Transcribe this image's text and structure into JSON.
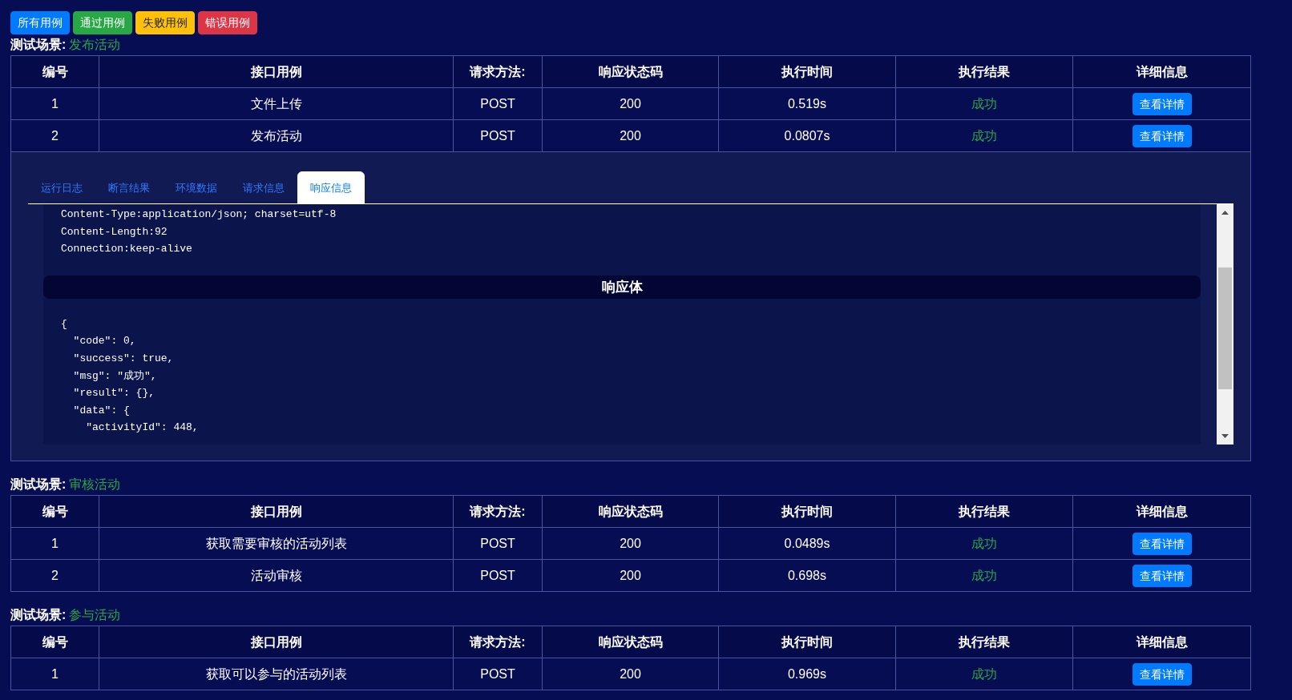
{
  "filters": [
    {
      "label": "所有用例",
      "color": "#007bff"
    },
    {
      "label": "通过用例",
      "color": "#28a745"
    },
    {
      "label": "失败用例",
      "color": "#ffc107"
    },
    {
      "label": "错误用例",
      "color": "#dc3545"
    }
  ],
  "scenes": [
    {
      "label": "测试场景:",
      "name": "发布活动",
      "table": {
        "columns": [
          "编号",
          "接口用例",
          "请求方法:",
          "响应状态码",
          "执行时间",
          "执行结果",
          "详细信息"
        ],
        "rows": [
          {
            "number": "1",
            "case": "文件上传",
            "method": "POST",
            "status_code": "200",
            "duration": "0.519s",
            "result": "成功",
            "passed": true,
            "action": "查看详情"
          },
          {
            "number": "2",
            "case": "发布活动",
            "method": "POST",
            "status_code": "200",
            "duration": "0.0807s",
            "result": "成功",
            "passed": true,
            "action": "查看详情"
          }
        ]
      },
      "detail": {
        "tabs": [
          {
            "label": "运行日志",
            "selected": false
          },
          {
            "label": "断言结果",
            "selected": false
          },
          {
            "label": "环境数据",
            "selected": false
          },
          {
            "label": "请求信息",
            "selected": false
          },
          {
            "label": "响应信息",
            "selected": true
          }
        ],
        "response_headers": [
          "Content-Type:application/json; charset=utf-8",
          "Content-Length:92",
          "Connection:keep-alive"
        ],
        "body_title": "响应体",
        "body_lines": [
          "{",
          "  \"code\": 0,",
          "  \"success\": true,",
          "  \"msg\": \"成功\",",
          "  \"result\": {},",
          "  \"data\": {",
          "    \"activityId\": 448,"
        ]
      }
    },
    {
      "label": "测试场景:",
      "name": "审核活动",
      "table": {
        "columns": [
          "编号",
          "接口用例",
          "请求方法:",
          "响应状态码",
          "执行时间",
          "执行结果",
          "详细信息"
        ],
        "rows": [
          {
            "number": "1",
            "case": "获取需要审核的活动列表",
            "method": "POST",
            "status_code": "200",
            "duration": "0.0489s",
            "result": "成功",
            "passed": true,
            "action": "查看详情"
          },
          {
            "number": "2",
            "case": "活动审核",
            "method": "POST",
            "status_code": "200",
            "duration": "0.698s",
            "result": "成功",
            "passed": true,
            "action": "查看详情"
          }
        ]
      }
    },
    {
      "label": "测试场景:",
      "name": "参与活动",
      "table": {
        "columns": [
          "编号",
          "接口用例",
          "请求方法:",
          "响应状态码",
          "执行时间",
          "执行结果",
          "详细信息"
        ],
        "rows": [
          {
            "number": "1",
            "case": "获取可以参与的活动列表",
            "method": "POST",
            "status_code": "200",
            "duration": "0.969s",
            "result": "成功",
            "passed": true,
            "action": "查看详情"
          }
        ]
      }
    }
  ]
}
